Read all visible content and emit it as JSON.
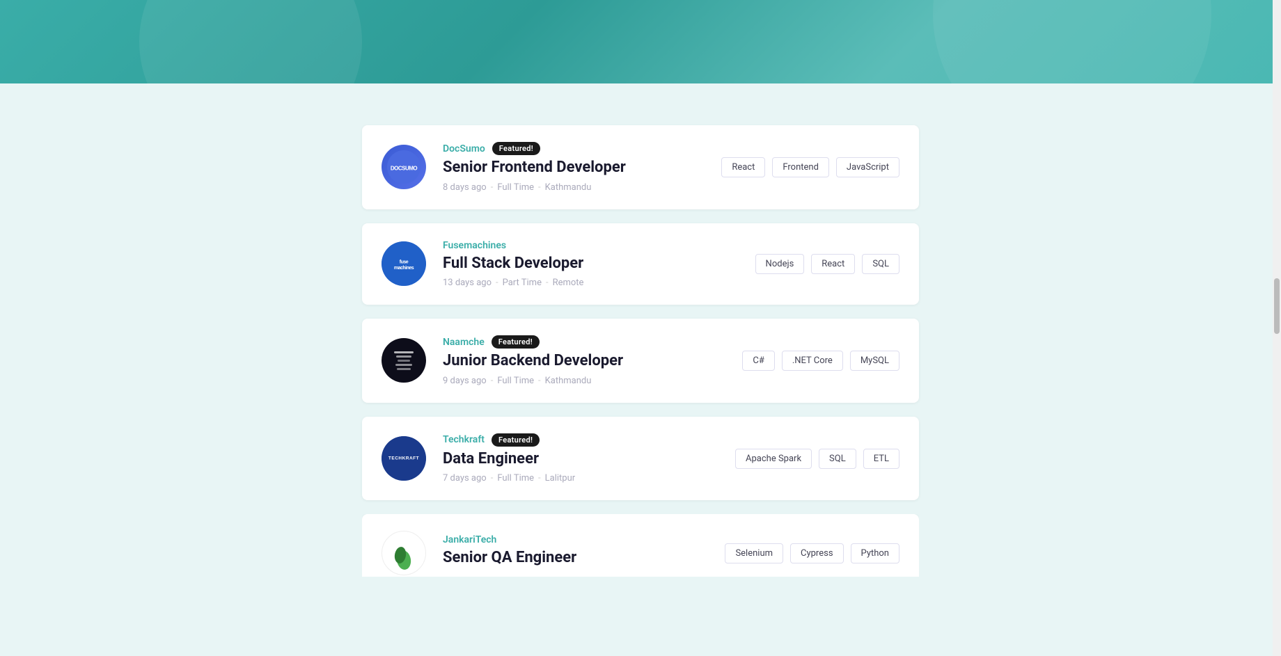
{
  "hero": {
    "visible": true
  },
  "jobs": [
    {
      "id": "job-1",
      "company": "DocSumo",
      "featured": true,
      "featuredLabel": "Featured!",
      "title": "Senior Frontend Developer",
      "postedAgo": "8 days ago",
      "jobType": "Full Time",
      "location": "Kathmandu",
      "tags": [
        "React",
        "Frontend",
        "JavaScript"
      ],
      "logoType": "docsumo",
      "logoText": "DOCSUMO"
    },
    {
      "id": "job-2",
      "company": "Fusemachines",
      "featured": false,
      "featuredLabel": "",
      "title": "Full Stack Developer",
      "postedAgo": "13 days ago",
      "jobType": "Part Time",
      "location": "Remote",
      "tags": [
        "Nodejs",
        "React",
        "SQL"
      ],
      "logoType": "fusemachines",
      "logoText": "fuse\nmachines"
    },
    {
      "id": "job-3",
      "company": "Naamche",
      "featured": true,
      "featuredLabel": "Featured!",
      "title": "Junior Backend Developer",
      "postedAgo": "9 days ago",
      "jobType": "Full Time",
      "location": "Kathmandu",
      "tags": [
        "C#",
        ".NET Core",
        "MySQL"
      ],
      "logoType": "naamche",
      "logoText": ""
    },
    {
      "id": "job-4",
      "company": "Techkraft",
      "featured": true,
      "featuredLabel": "Featured!",
      "title": "Data Engineer",
      "postedAgo": "7 days ago",
      "jobType": "Full Time",
      "location": "Lalitpur",
      "tags": [
        "Apache Spark",
        "SQL",
        "ETL"
      ],
      "logoType": "techkraft",
      "logoText": "TECHKRAFT"
    },
    {
      "id": "job-5",
      "company": "JankariTech",
      "featured": false,
      "featuredLabel": "",
      "title": "Senior QA Engineer",
      "postedAgo": "",
      "jobType": "",
      "location": "",
      "tags": [
        "Selenium",
        "Cypress",
        "Python"
      ],
      "logoType": "jankari",
      "logoText": ""
    }
  ],
  "scrollbar": {
    "visible": true
  }
}
